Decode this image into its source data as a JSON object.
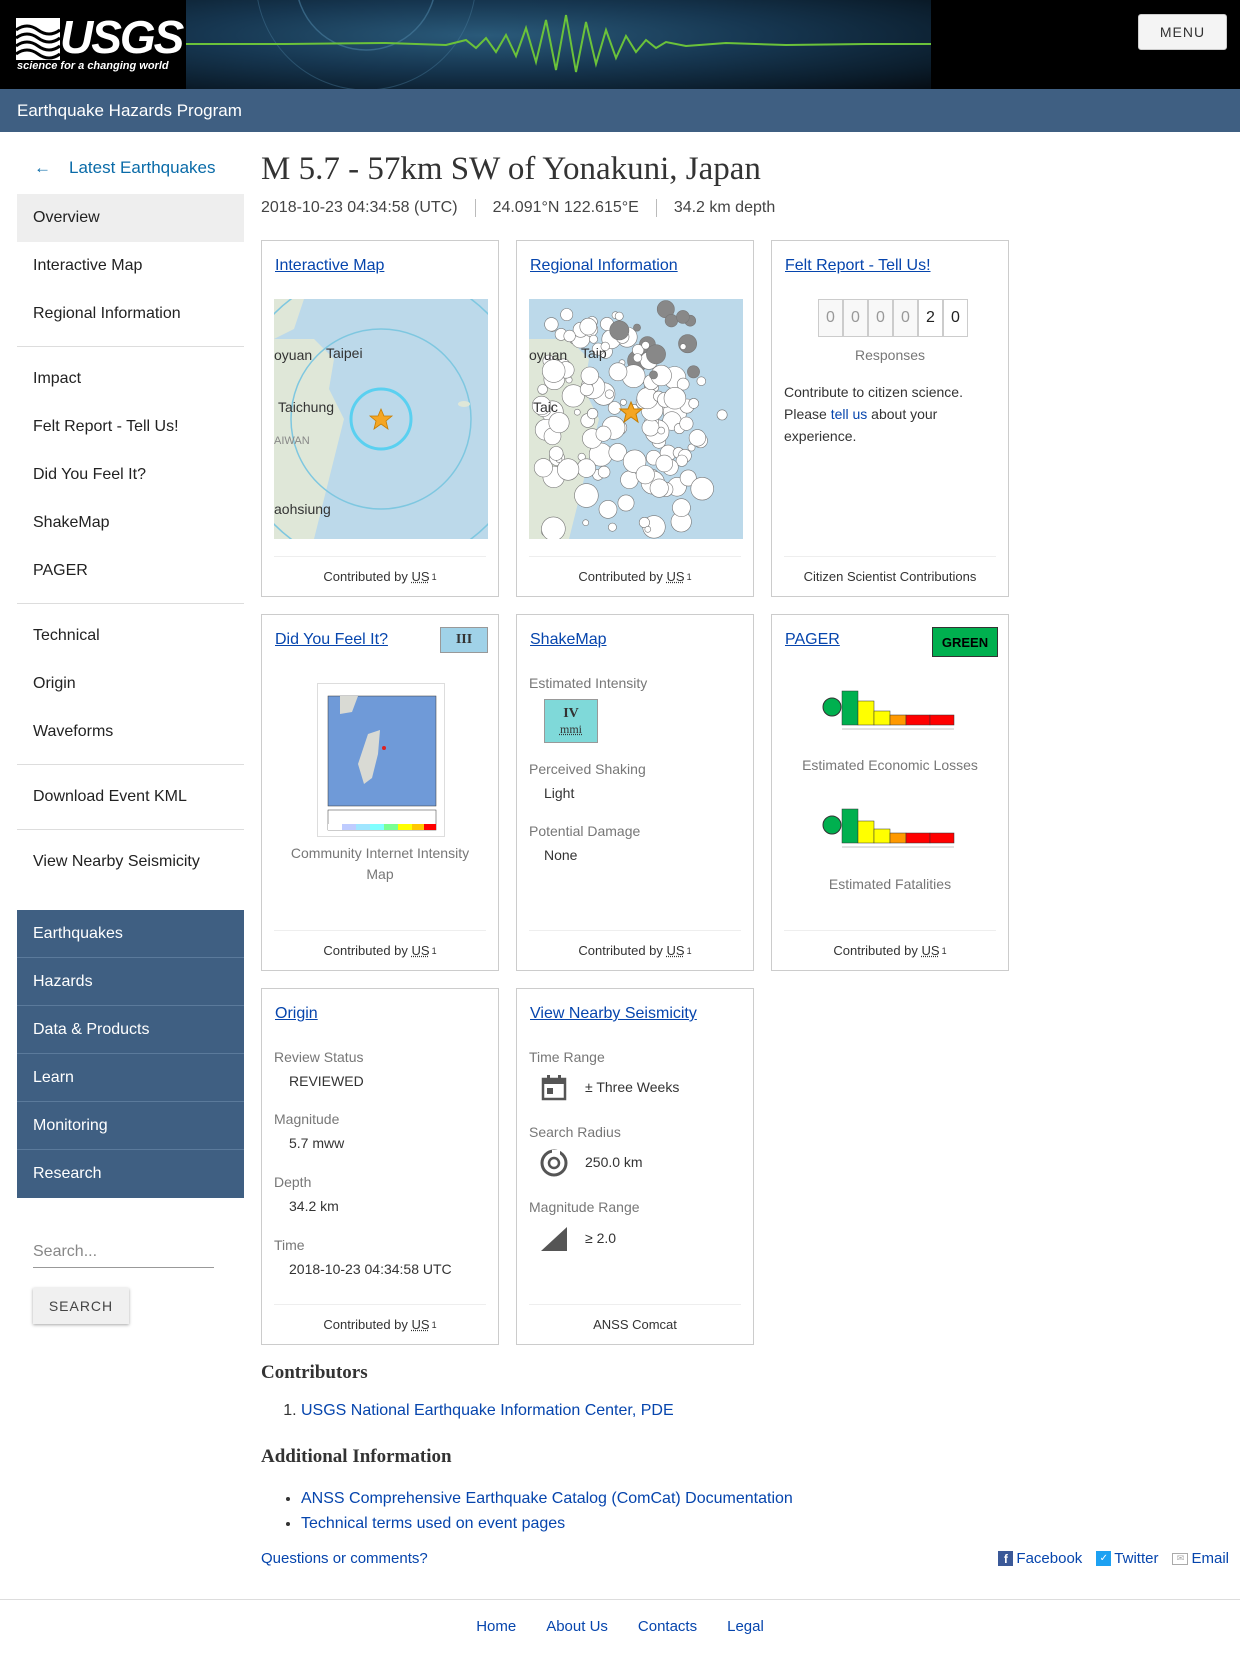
{
  "header": {
    "logo_text": "USGS",
    "logo_tagline": "science for a changing world",
    "menu_label": "MENU",
    "program": "Earthquake Hazards Program"
  },
  "sidebar": {
    "back_label": "Latest Earthquakes",
    "group1": [
      "Overview",
      "Interactive Map",
      "Regional Information"
    ],
    "group2": [
      "Impact",
      "Felt Report - Tell Us!",
      "Did You Feel It?",
      "ShakeMap",
      "PAGER"
    ],
    "group3": [
      "Technical",
      "Origin",
      "Waveforms"
    ],
    "group4": [
      "Download Event KML"
    ],
    "group5": [
      "View Nearby Seismicity"
    ],
    "nav": [
      "Earthquakes",
      "Hazards",
      "Data & Products",
      "Learn",
      "Monitoring",
      "Research"
    ],
    "search_placeholder": "Search...",
    "search_button": "SEARCH"
  },
  "event": {
    "title": "M 5.7 - 57km SW of Yonakuni, Japan",
    "time": "2018-10-23 04:34:58 (UTC)",
    "location": "24.091°N 122.615°E",
    "depth": "34.2 km depth"
  },
  "cards": {
    "interactive_map": {
      "title": "Interactive Map",
      "contributed": "Contributed by",
      "source": "US",
      "sup": "1",
      "map_labels": [
        "oyuan",
        "Taipei",
        "Taichung",
        "AIWAN",
        "aohsiung"
      ]
    },
    "regional": {
      "title": "Regional Information",
      "contributed": "Contributed by",
      "source": "US",
      "sup": "1",
      "map_labels": [
        "oyuan",
        "Taip",
        "Taic"
      ]
    },
    "felt_report": {
      "title": "Felt Report - Tell Us!",
      "digits": [
        "0",
        "0",
        "0",
        "0",
        "2",
        "0"
      ],
      "responses_label": "Responses",
      "text_before": "Contribute to citizen science. Please ",
      "link": "tell us",
      "text_after": " about your experience.",
      "footer": "Citizen Scientist Contributions"
    },
    "dyfi": {
      "title": "Did You Feel It?",
      "intensity": "III",
      "intensity_color": "#a0d2e8",
      "caption": "Community Internet Intensity Map",
      "contributed": "Contributed by",
      "source": "US",
      "sup": "1"
    },
    "shakemap": {
      "title": "ShakeMap",
      "est_label": "Estimated Intensity",
      "intensity": "IV",
      "intensity_unit": "mmi",
      "intensity_color": "#7fd9d9",
      "shaking_label": "Perceived Shaking",
      "shaking": "Light",
      "damage_label": "Potential Damage",
      "damage": "None",
      "contributed": "Contributed by",
      "source": "US",
      "sup": "1"
    },
    "pager": {
      "title": "PAGER",
      "alert": "GREEN",
      "alert_color": "#00b04f",
      "losses_label": "Estimated Economic Losses",
      "fatalities_label": "Estimated Fatalities",
      "contributed": "Contributed by",
      "source": "US",
      "sup": "1"
    },
    "origin": {
      "title": "Origin",
      "review_label": "Review Status",
      "review": "REVIEWED",
      "mag_label": "Magnitude",
      "mag": "5.7 mww",
      "depth_label": "Depth",
      "depth": "34.2 km",
      "time_label": "Time",
      "time": "2018-10-23 04:34:58 UTC",
      "contributed": "Contributed by",
      "source": "US",
      "sup": "1"
    },
    "nearby": {
      "title": "View Nearby Seismicity",
      "time_label": "Time Range",
      "time": "± Three Weeks",
      "radius_label": "Search Radius",
      "radius": "250.0 km",
      "mag_label": "Magnitude Range",
      "mag": "≥ 2.0",
      "footer": "ANSS Comcat"
    }
  },
  "contributors": {
    "heading": "Contributors",
    "items": [
      "USGS National Earthquake Information Center, PDE"
    ]
  },
  "additional": {
    "heading": "Additional Information",
    "items": [
      "ANSS Comprehensive Earthquake Catalog (ComCat) Documentation",
      "Technical terms used on event pages"
    ]
  },
  "questions": "Questions or comments?",
  "social": [
    "Facebook",
    "Twitter",
    "Email"
  ],
  "footer": [
    "Home",
    "About Us",
    "Contacts",
    "Legal"
  ]
}
